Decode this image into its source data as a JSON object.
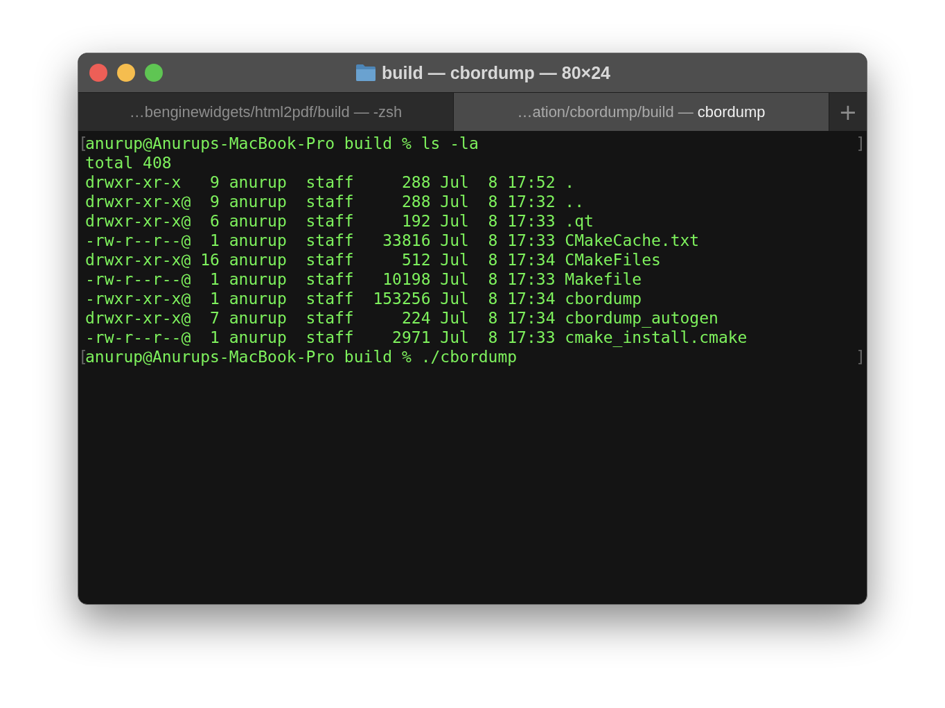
{
  "window": {
    "title": "build — cbordump — 80×24"
  },
  "tabs": [
    {
      "path": "…benginewidgets/html2pdf/build —",
      "process": "-zsh",
      "selected": false
    },
    {
      "path": "…ation/cbordump/build —",
      "process": "cbordump",
      "selected": true
    }
  ],
  "new_tab": "+",
  "terminal": {
    "lines": [
      {
        "kind": "prompt",
        "mark_open": "[",
        "text": "anurup@Anurups-MacBook-Pro build % ls -la",
        "mark_close": "]"
      },
      {
        "kind": "output",
        "text": "total 408"
      },
      {
        "kind": "output",
        "text": "drwxr-xr-x   9 anurup  staff     288 Jul  8 17:52 ."
      },
      {
        "kind": "output",
        "text": "drwxr-xr-x@  9 anurup  staff     288 Jul  8 17:32 .."
      },
      {
        "kind": "output",
        "text": "drwxr-xr-x@  6 anurup  staff     192 Jul  8 17:33 .qt"
      },
      {
        "kind": "output",
        "text": "-rw-r--r--@  1 anurup  staff   33816 Jul  8 17:33 CMakeCache.txt"
      },
      {
        "kind": "output",
        "text": "drwxr-xr-x@ 16 anurup  staff     512 Jul  8 17:34 CMakeFiles"
      },
      {
        "kind": "output",
        "text": "-rw-r--r--@  1 anurup  staff   10198 Jul  8 17:33 Makefile"
      },
      {
        "kind": "output",
        "text": "-rwxr-xr-x@  1 anurup  staff  153256 Jul  8 17:34 cbordump"
      },
      {
        "kind": "output",
        "text": "drwxr-xr-x@  7 anurup  staff     224 Jul  8 17:34 cbordump_autogen"
      },
      {
        "kind": "output",
        "text": "-rw-r--r--@  1 anurup  staff    2971 Jul  8 17:33 cmake_install.cmake"
      },
      {
        "kind": "prompt",
        "mark_open": "[",
        "text": "anurup@Anurups-MacBook-Pro build % ./cbordump",
        "mark_close": "]"
      }
    ]
  }
}
